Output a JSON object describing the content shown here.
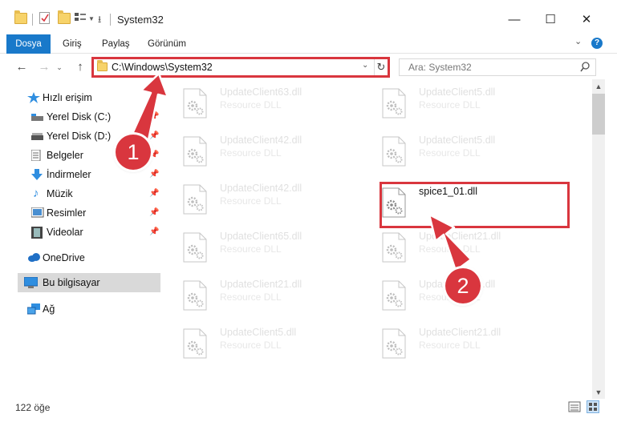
{
  "window": {
    "title": "System32"
  },
  "ribbon": {
    "tabs": [
      "Dosya",
      "Giriş",
      "Paylaş",
      "Görünüm"
    ]
  },
  "address": {
    "path": "C:\\Windows\\System32"
  },
  "search": {
    "placeholder": "Ara: System32"
  },
  "sidebar": {
    "items": [
      {
        "label": "Hızlı erişim"
      },
      {
        "label": "Yerel Disk (C:)"
      },
      {
        "label": "Yerel Disk (D:)"
      },
      {
        "label": "Belgeler"
      },
      {
        "label": "İndirmeler"
      },
      {
        "label": "Müzik"
      },
      {
        "label": "Resimler"
      },
      {
        "label": "Videolar"
      },
      {
        "label": "OneDrive"
      },
      {
        "label": "Bu bilgisayar"
      },
      {
        "label": "Ağ"
      }
    ]
  },
  "files": [
    {
      "name": "UpdateClient63.dll",
      "type": "Resource DLL"
    },
    {
      "name": "UpdateClient5.dll",
      "type": "Resource DLL"
    },
    {
      "name": "UpdateClient42.dll",
      "type": "Resource DLL"
    },
    {
      "name": "UpdateClient5.dll",
      "type": "Resource DLL"
    },
    {
      "name": "UpdateClient42.dll",
      "type": "Resource DLL"
    },
    {
      "name": "spice1_01.dll",
      "type": ""
    },
    {
      "name": "UpdateClient65.dll",
      "type": "Resource DLL"
    },
    {
      "name": "UpdateClient21.dll",
      "type": "Resource DLL"
    },
    {
      "name": "UpdateClient21.dll",
      "type": "Resource DLL"
    },
    {
      "name": "UpdateClient5.dll",
      "type": "Resource DLL"
    },
    {
      "name": "UpdateClient5.dll",
      "type": "Resource DLL"
    },
    {
      "name": "UpdateClient21.dll",
      "type": "Resource DLL"
    }
  ],
  "status": {
    "count": "122 öğe"
  },
  "callouts": {
    "one": "1",
    "two": "2"
  },
  "colors": {
    "accent": "#1979ca",
    "highlight": "#d9363e"
  }
}
